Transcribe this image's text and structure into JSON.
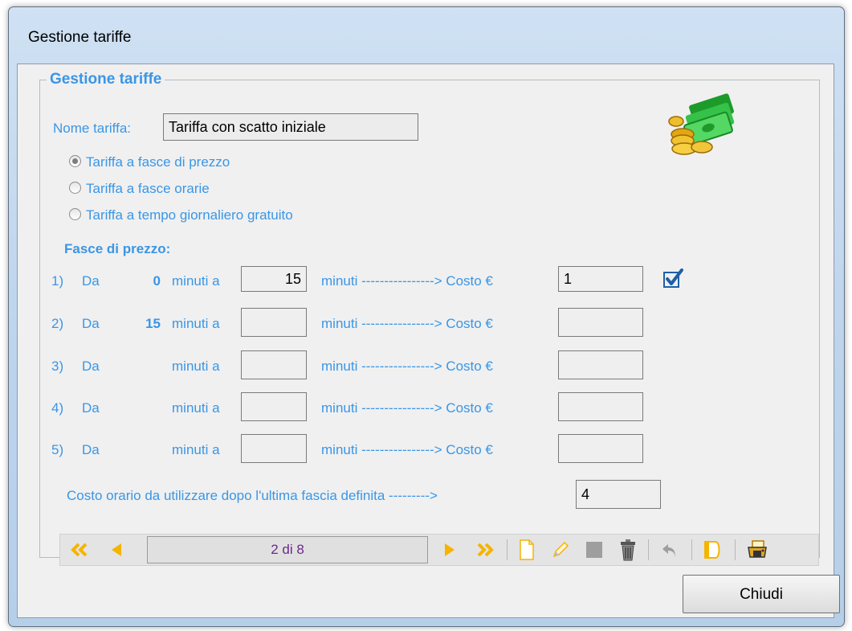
{
  "window": {
    "title": "Gestione tariffe"
  },
  "group": {
    "title": "Gestione tariffe"
  },
  "name": {
    "label": "Nome tariffa:",
    "value": "Tariffa con scatto iniziale"
  },
  "tariff_types": [
    {
      "label": "Tariffa a fasce di prezzo",
      "selected": true
    },
    {
      "label": "Tariffa a fasce orarie",
      "selected": false
    },
    {
      "label": "Tariffa a tempo giornaliero gratuito",
      "selected": false
    }
  ],
  "bands": {
    "heading": "Fasce di prezzo:",
    "da_label": "Da",
    "minuti_a_label": "minuti a",
    "arrow_label": "minuti ----------------> Costo €",
    "rows": [
      {
        "index": "1)",
        "from": "0",
        "to": "15",
        "cost": "1"
      },
      {
        "index": "2)",
        "from": "15",
        "to": "",
        "cost": ""
      },
      {
        "index": "3)",
        "from": "",
        "to": "",
        "cost": ""
      },
      {
        "index": "4)",
        "from": "",
        "to": "",
        "cost": ""
      },
      {
        "index": "5)",
        "from": "",
        "to": "",
        "cost": ""
      }
    ]
  },
  "hourly": {
    "label": "Costo orario da utilizzare dopo l'ultima fascia definita --------->",
    "value": "4"
  },
  "navigator": {
    "record": "2 di 8"
  },
  "buttons": {
    "close": "Chiudi"
  },
  "colors": {
    "label_blue": "#3a96e6",
    "record_text": "#6b2a8c",
    "nav_arrow": "#f5b400"
  }
}
